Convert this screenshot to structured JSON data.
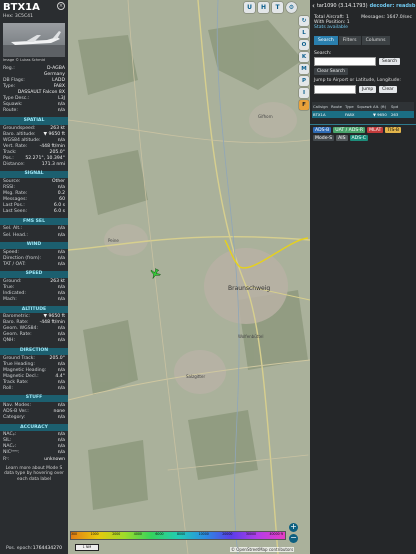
{
  "aircraft": {
    "callsign": "BTX1A",
    "hex_line": "Hex: 3C5C41",
    "photo_credit": "Image © Lukas Schmid",
    "close_icon": "close-icon"
  },
  "details": [
    {
      "k": "Reg.:",
      "v": "D-AGBA"
    },
    {
      "k": "",
      "v": "Germany"
    },
    {
      "k": "DB Flags:",
      "v": "LADD"
    },
    {
      "k": "Type:",
      "v": "FA8X"
    },
    {
      "k": "",
      "v": "DASSAULT Falcon 8X"
    },
    {
      "k": "Type Desc.:",
      "v": "L3J"
    },
    {
      "k": "Squawk:",
      "v": "n/a"
    },
    {
      "k": "Route:",
      "v": "n/a"
    }
  ],
  "sections": [
    {
      "title": "SPATIAL",
      "rows": [
        {
          "k": "Groundspeed:",
          "v": "263 kt"
        },
        {
          "k": "Baro. altitude:",
          "v": "▼ 9650 ft"
        },
        {
          "k": "WGS84 altitude:",
          "v": "n/a"
        },
        {
          "k": "Vert. Rate:",
          "v": "-448 ft/min"
        },
        {
          "k": "Track:",
          "v": "205.0°"
        },
        {
          "k": "Pos.:",
          "v": "52.271°, 10.394°"
        },
        {
          "k": "Distance:",
          "v": "171.3 nmi"
        }
      ]
    },
    {
      "title": "SIGNAL",
      "rows": [
        {
          "k": "Source:",
          "v": "Other"
        },
        {
          "k": "RSSI:",
          "v": "n/a"
        },
        {
          "k": "Msg. Rate:",
          "v": "0.2"
        },
        {
          "k": "Messages:",
          "v": "60"
        },
        {
          "k": "Last Pos.:",
          "v": "6.0 s"
        },
        {
          "k": "Last Seen:",
          "v": "6.0 s"
        }
      ]
    },
    {
      "title": "FMS SEL",
      "rows": [
        {
          "k": "Sel. Alt.:",
          "v": "n/a"
        },
        {
          "k": "Sel. Head.:",
          "v": "n/a"
        }
      ]
    },
    {
      "title": "WIND",
      "rows": [
        {
          "k": "Speed:",
          "v": "n/a"
        },
        {
          "k": "Direction (from):",
          "v": "n/a"
        },
        {
          "k": "TAT / OAT:",
          "v": "n/a"
        }
      ]
    },
    {
      "title": "SPEED",
      "rows": [
        {
          "k": "Ground:",
          "v": "263 kt"
        },
        {
          "k": "True:",
          "v": "n/a"
        },
        {
          "k": "Indicated:",
          "v": "n/a"
        },
        {
          "k": "Mach:",
          "v": "n/a"
        }
      ]
    },
    {
      "title": "ALTITUDE",
      "rows": [
        {
          "k": "Barometric:",
          "v": "▼ 9650 ft"
        },
        {
          "k": "Baro. Rate:",
          "v": "-448 ft/min"
        },
        {
          "k": "Geom. WGS84:",
          "v": "n/a"
        },
        {
          "k": "Geom. Rate:",
          "v": "n/a"
        },
        {
          "k": "QNH:",
          "v": "n/a"
        }
      ]
    },
    {
      "title": "DIRECTION",
      "rows": [
        {
          "k": "Ground Track:",
          "v": "205.0°"
        },
        {
          "k": "True Heading:",
          "v": "n/a"
        },
        {
          "k": "Magnetic Heading:",
          "v": "n/a"
        },
        {
          "k": "Magnetic Decl.:",
          "v": "4.4°"
        },
        {
          "k": "Track Rate:",
          "v": "n/a"
        },
        {
          "k": "Roll:",
          "v": "n/a"
        }
      ]
    },
    {
      "title": "STUFF",
      "rows": [
        {
          "k": "Nav. Modes:",
          "v": "n/a"
        },
        {
          "k": "ADS-B Ver.:",
          "v": "none"
        },
        {
          "k": "Category:",
          "v": "n/a"
        }
      ]
    },
    {
      "title": "ACCURACY",
      "rows": [
        {
          "k": "NACₚ:",
          "v": "n/a"
        },
        {
          "k": "SIL:",
          "v": "n/a"
        },
        {
          "k": "NACᵥ:",
          "v": "n/a"
        },
        {
          "k": "NICᵇᵃʳᵒ:",
          "v": "n/a"
        },
        {
          "k": "Rᶜ:",
          "v": "unknown"
        }
      ]
    }
  ],
  "footer_note": "Learn more about Mode S data type by hovering over each data label",
  "pos_epoch": {
    "k": "Pos. epoch:",
    "v": "1764434270"
  },
  "map": {
    "top_buttons": [
      "U",
      "H",
      "T"
    ],
    "side_buttons": [
      "L",
      "O",
      "K",
      "M",
      "P",
      "I",
      "F"
    ],
    "scale": "1 NM",
    "attribution": "© OpenStreetMap contributors",
    "city_label": "Braunschweig",
    "places": [
      "Gifhorn",
      "Wolfenbüttel",
      "Salzgitter",
      "Peine"
    ],
    "altitude_labels": [
      "300",
      "1000",
      "2000",
      "4000",
      "6000",
      "8000",
      "10000",
      "20000",
      "30000",
      "40000 ft"
    ],
    "colors": {
      "track": "#e6d11c",
      "aircraft": "#36c93a",
      "accent": "#1b6e83"
    }
  },
  "right": {
    "version_prefix": "tar1090 (3.14.1793)",
    "decoder_label": "decoder: readsb",
    "total_aircraft": "Total Aircraft: 1",
    "with_position": "With Position: 1",
    "messages": "Messages: 1647.0/sec",
    "stats_available": "Stats available",
    "tabs": [
      "Search",
      "Filters",
      "Columns"
    ],
    "search_label": "Search:",
    "search_button": "Search",
    "clear_search": "Clear Search",
    "jump_label": "Jump to Airport or Latitude, Longitude:",
    "jump_button": "Jump",
    "clear_button": "Clear",
    "table_headers": [
      "Callsign",
      "Route",
      "Type",
      "Squawk",
      "Alt. (ft)",
      "Spd"
    ],
    "table_row": [
      "BTX1A",
      "",
      "FA8X",
      "",
      "▼ 9650",
      "263"
    ],
    "badges": [
      {
        "label": "ADS-B",
        "bg": "#2f6bb5",
        "fg": "#ffffff"
      },
      {
        "label": "UAT / ADS-R",
        "bg": "#4aa36b",
        "fg": "#ffffff"
      },
      {
        "label": "MLAT",
        "bg": "#c23b3b",
        "fg": "#ffffff"
      },
      {
        "label": "TIS-B",
        "bg": "#e3b54b",
        "fg": "#111111"
      },
      {
        "label": "Mode-S",
        "bg": "#444a4e",
        "fg": "#ffffff"
      },
      {
        "label": "AIS",
        "bg": "#555b5e",
        "fg": "#ffffff"
      },
      {
        "label": "ADS-C",
        "bg": "#1d8c7a",
        "fg": "#ffffff"
      }
    ]
  }
}
